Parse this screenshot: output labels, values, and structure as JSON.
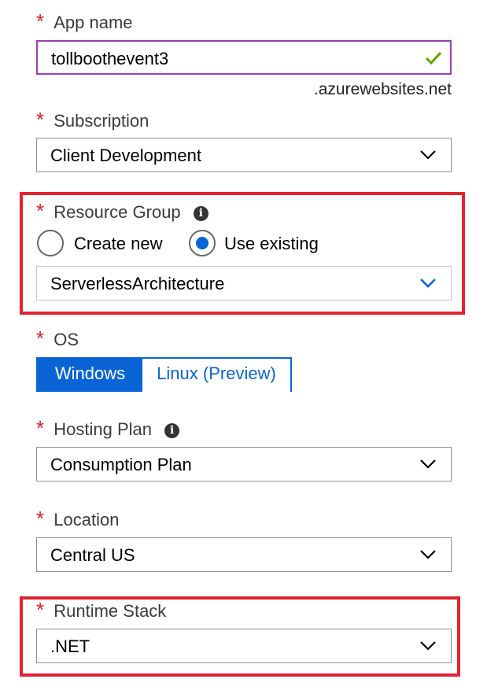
{
  "app_name": {
    "label": "App name",
    "value": "tollboothevent3",
    "suffix": ".azurewebsites.net",
    "valid_icon": "check-icon"
  },
  "subscription": {
    "label": "Subscription",
    "value": "Client Development"
  },
  "resource_group": {
    "label": "Resource Group",
    "options": [
      "Create new",
      "Use existing"
    ],
    "selected": "Use existing",
    "value": "ServerlessArchitecture"
  },
  "os": {
    "label": "OS",
    "options": [
      "Windows",
      "Linux (Preview)"
    ],
    "selected": "Windows"
  },
  "hosting_plan": {
    "label": "Hosting Plan",
    "value": "Consumption Plan"
  },
  "location": {
    "label": "Location",
    "value": "Central US"
  },
  "runtime_stack": {
    "label": "Runtime Stack",
    "value": ".NET"
  },
  "required_marker": "*",
  "colors": {
    "accent": "#0a64d6",
    "required": "#d8202a",
    "highlight_border": "#e3232f",
    "focus_border": "#9b3db5",
    "valid": "#5ea400"
  }
}
